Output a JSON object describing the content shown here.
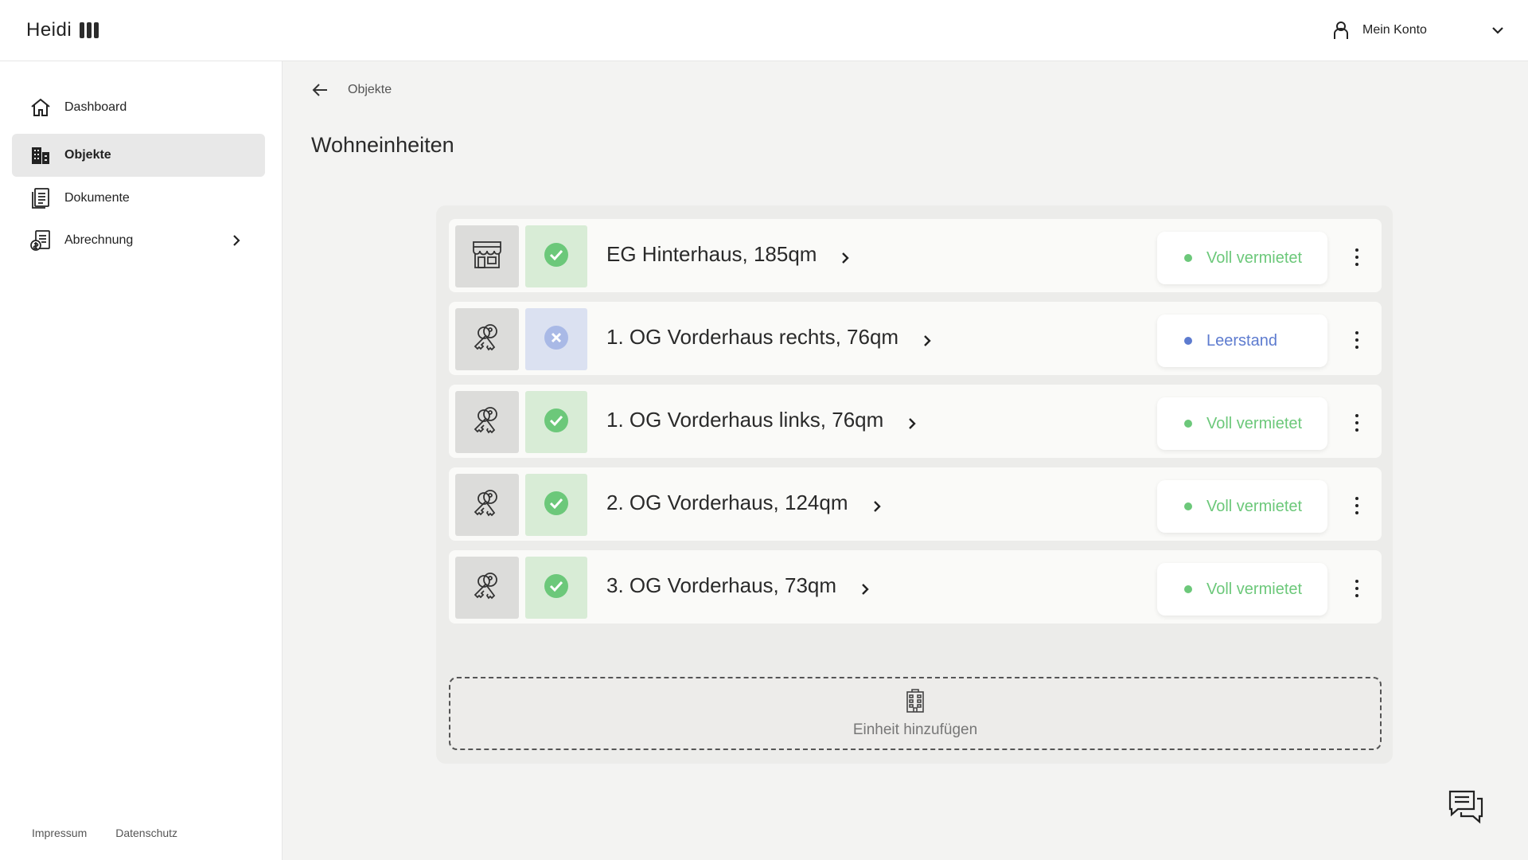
{
  "header": {
    "logo_text": "Heidi",
    "account_label": "Mein Konto"
  },
  "sidebar": {
    "items": [
      {
        "label": "Dashboard",
        "icon": "home-icon",
        "active": false
      },
      {
        "label": "Objekte",
        "icon": "buildings-icon",
        "active": true
      },
      {
        "label": "Dokumente",
        "icon": "document-icon",
        "active": false
      },
      {
        "label": "Abrechnung",
        "icon": "invoice-icon",
        "active": false,
        "has_submenu": true
      }
    ],
    "footer": {
      "impressum": "Impressum",
      "datenschutz": "Datenschutz"
    }
  },
  "breadcrumb": {
    "label": "Objekte"
  },
  "page": {
    "title": "Wohneinheiten"
  },
  "units": [
    {
      "title": "EG Hinterhaus, 185qm",
      "type_icon": "shop-icon",
      "status": "Voll vermietet",
      "status_kind": "rented"
    },
    {
      "title": "1. OG Vorderhaus rechts, 76qm",
      "type_icon": "keys-icon",
      "status": "Leerstand",
      "status_kind": "vacant"
    },
    {
      "title": "1. OG Vorderhaus links, 76qm",
      "type_icon": "keys-icon",
      "status": "Voll vermietet",
      "status_kind": "rented"
    },
    {
      "title": "2. OG Vorderhaus, 124qm",
      "type_icon": "keys-icon",
      "status": "Voll vermietet",
      "status_kind": "rented"
    },
    {
      "title": "3. OG Vorderhaus, 73qm",
      "type_icon": "keys-icon",
      "status": "Voll vermietet",
      "status_kind": "rented"
    }
  ],
  "add_unit": {
    "label": "Einheit hinzufügen",
    "icon": "apartment-building-icon"
  },
  "chat": {
    "icon": "chat-icon"
  },
  "colors": {
    "rented": "#6cc87a",
    "rented_bg": "#d8ecd6",
    "vacant": "#5d7bcf",
    "vacant_bg": "#dbe1f1",
    "active_nav_bg": "#e8e8e8"
  }
}
